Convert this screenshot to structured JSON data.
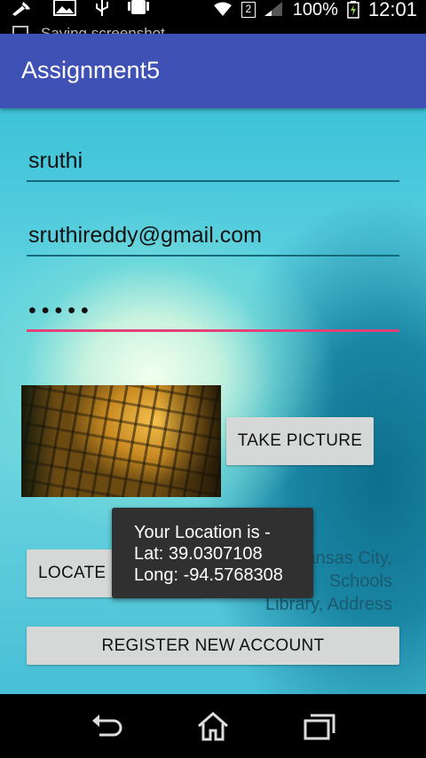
{
  "status_bar": {
    "battery": "100%",
    "time": "12:01",
    "sim_badge": "2",
    "notification_text": "Saving screenshot",
    "icons": [
      "wrench-icon",
      "image-icon",
      "usb-icon",
      "android-icon",
      "wifi-icon",
      "signal-icon",
      "battery-charging-icon"
    ]
  },
  "app_bar": {
    "title": "Assignment5",
    "color": "#3f51b5"
  },
  "form": {
    "name_value": "sruthi",
    "email_value": "sruthireddy@gmail.com",
    "password_value": "•••••",
    "accent_color": "#e4407a"
  },
  "buttons": {
    "take_picture": "TAKE PICTURE",
    "locate": "LOCATE ME",
    "register": "REGISTER NEW ACCOUNT"
  },
  "address": {
    "line1": "Kansas City,",
    "line2": "Schools",
    "line3": "Library, Address"
  },
  "toast": {
    "line1": "Your Location is -",
    "line2": "Lat: 39.0307108",
    "line3": "Long: -94.5768308"
  },
  "nav_bar": {
    "icons": [
      "back-icon",
      "home-icon",
      "recents-icon"
    ]
  }
}
